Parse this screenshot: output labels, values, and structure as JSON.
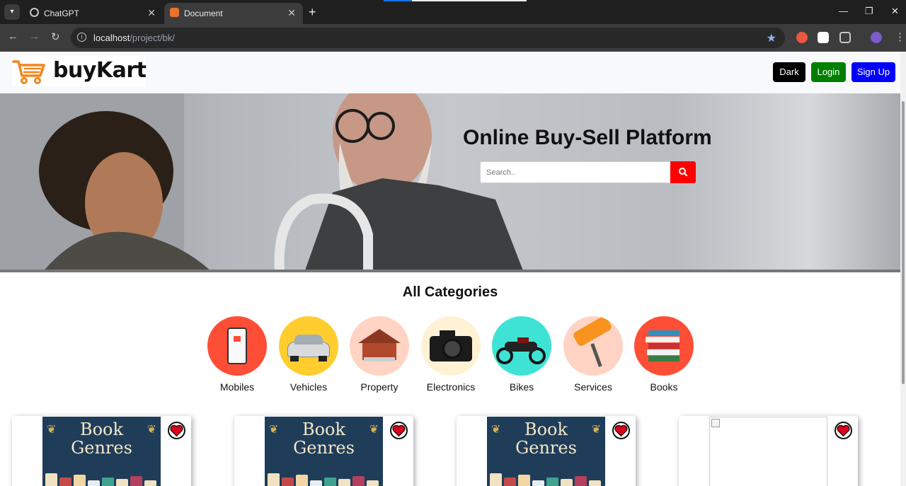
{
  "browser": {
    "tabs": [
      {
        "title": "ChatGPT"
      },
      {
        "title": "Document"
      }
    ],
    "url_host": "localhost",
    "url_path": "/project/bk/"
  },
  "header": {
    "logo_text": "buyKart",
    "buttons": {
      "dark": "Dark",
      "login": "Login",
      "signup": "Sign Up"
    }
  },
  "hero": {
    "title": "Online Buy-Sell Platform",
    "search_placeholder": "Search.."
  },
  "categories": {
    "title": "All Categories",
    "items": [
      {
        "label": "Mobiles",
        "color": "#ff4e36"
      },
      {
        "label": "Vehicles",
        "color": "#ffce2e"
      },
      {
        "label": "Property",
        "color": "#ffd4c4"
      },
      {
        "label": "Electronics",
        "color": "#fff2d4"
      },
      {
        "label": "Bikes",
        "color": "#3fe3d6"
      },
      {
        "label": "Services",
        "color": "#ffd4c4"
      },
      {
        "label": "Books",
        "color": "#ff4e36"
      }
    ]
  },
  "products": {
    "book_title_line1": "Book",
    "book_title_line2": "Genres"
  },
  "colors": {
    "dark": "#000000",
    "login": "#008000",
    "signup": "#0000ff",
    "search_button": "#ff0000",
    "heart": "#e0001b"
  }
}
